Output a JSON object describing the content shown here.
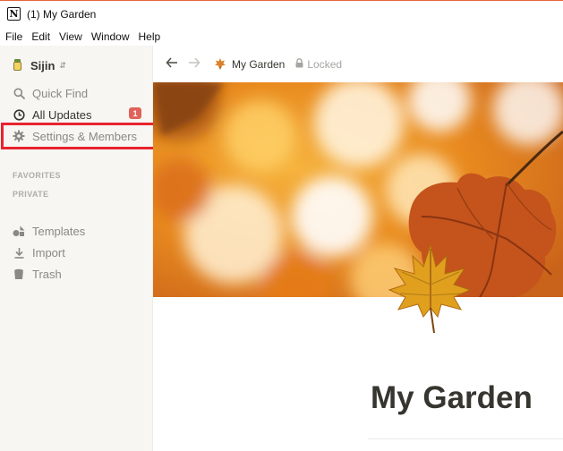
{
  "window": {
    "title": "(1) My Garden"
  },
  "menu": [
    "File",
    "Edit",
    "View",
    "Window",
    "Help"
  ],
  "sidebar": {
    "workspace_name": "Sijin",
    "quick_find": "Quick Find",
    "all_updates": "All Updates",
    "updates_count": "1",
    "settings": "Settings & Members",
    "favorites_header": "FAVORITES",
    "private_header": "PRIVATE",
    "templates": "Templates",
    "import": "Import",
    "trash": "Trash"
  },
  "topbar": {
    "breadcrumb_title": "My Garden",
    "lock_label": "Locked"
  },
  "page": {
    "title": "My Garden"
  },
  "colors": {
    "highlight": "#e8242e",
    "badge": "#e16259",
    "sidebar_bg": "#f7f6f3"
  },
  "icons": {
    "app": "notion-logo-icon",
    "workspace": "honey-jar-icon",
    "quick_find": "search-icon",
    "all_updates": "clock-icon",
    "settings": "gear-icon",
    "templates": "shapes-icon",
    "import": "download-icon",
    "trash": "trash-icon",
    "back": "arrow-left-icon",
    "forward": "arrow-right-icon",
    "page": "maple-leaf-icon",
    "lock": "lock-icon"
  }
}
